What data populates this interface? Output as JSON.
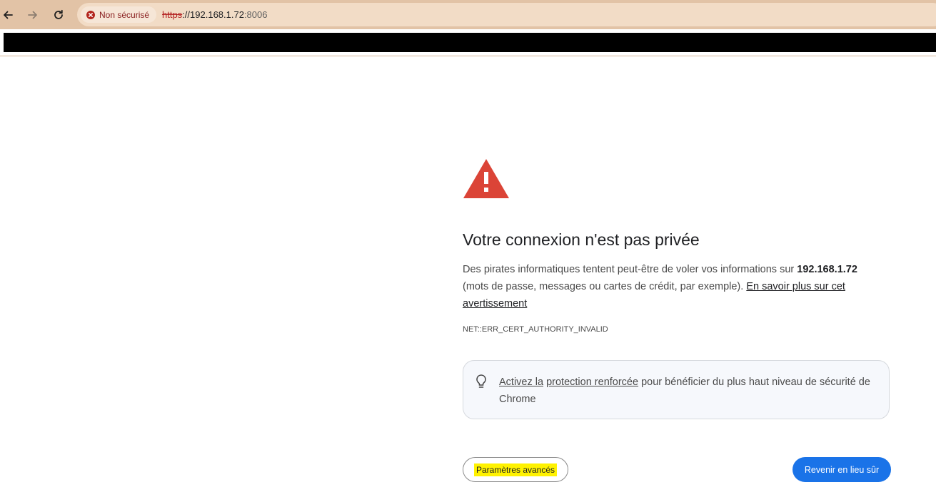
{
  "toolbar": {
    "security_chip": "Non sécurisé",
    "url_scheme": "https",
    "url_separator": "://",
    "url_host": "192.168.1.72",
    "url_port": ":8006"
  },
  "interstitial": {
    "headline": "Votre connexion n'est pas privée",
    "explanation_before": "Des pirates informatiques tentent peut-être de voler vos informations sur ",
    "host": "192.168.1.72",
    "explanation_after": " (mots de passe, messages ou cartes de crédit, par exemple). ",
    "learn_more_link": "En savoir plus sur cet avertissement",
    "error_code": "NET::ERR_CERT_AUTHORITY_INVALID",
    "card_link_part1": "Activez la",
    "card_link_part2": "protection renforcée",
    "card_text": " pour bénéficier du plus haut niveau de sécurité de Chrome",
    "advanced_button": "Paramètres avancés",
    "back_button": "Revenir en lieu sûr"
  },
  "colors": {
    "toolbar_bg": "#e2c3a6",
    "warning_red": "#db4437",
    "primary_button": "#1a73e8",
    "highlight": "#fff200"
  },
  "icons": {
    "back": "arrow-left-icon",
    "forward": "arrow-right-icon",
    "reload": "reload-icon",
    "security": "not-secure-icon",
    "warning": "warning-triangle-icon",
    "bulb": "lightbulb-icon"
  }
}
